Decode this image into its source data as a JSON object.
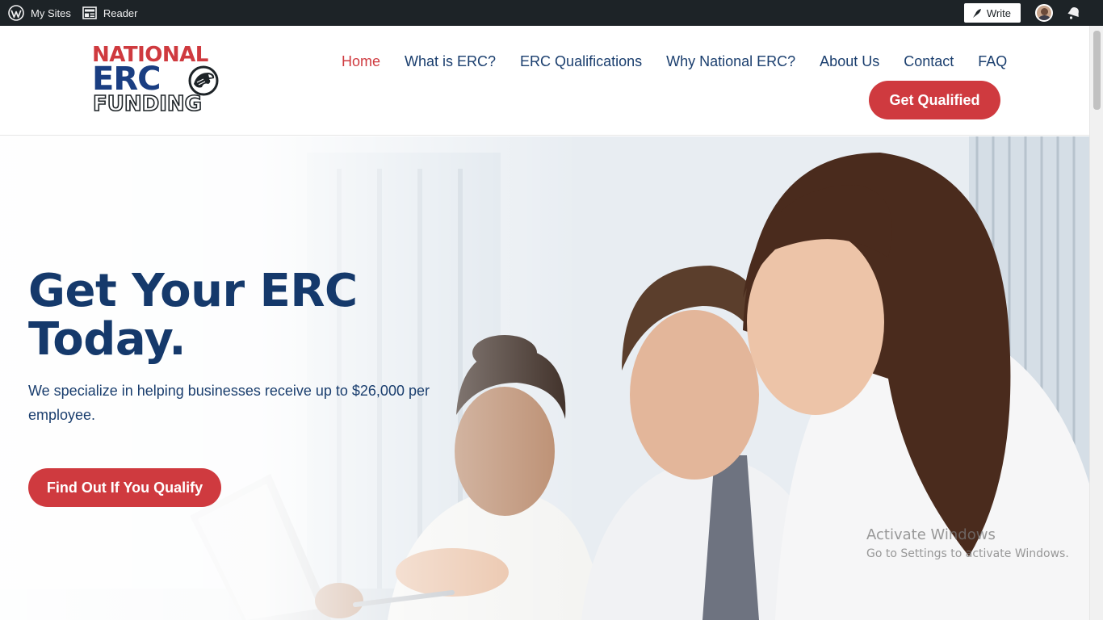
{
  "admin_bar": {
    "my_sites": "My Sites",
    "reader": "Reader",
    "write": "Write"
  },
  "header": {
    "logo": {
      "line1": "NATIONAL",
      "line2": "ERC",
      "line3": "FUNDING"
    },
    "nav": {
      "home": "Home",
      "what_is_erc": "What is ERC?",
      "erc_qualifications": "ERC Qualifications",
      "why_national_erc": "Why National ERC?",
      "about_us": "About Us",
      "contact": "Contact",
      "faq": "FAQ"
    },
    "cta_label": "Get Qualified"
  },
  "hero": {
    "title_line1": "Get Your ERC",
    "title_line2": "Today.",
    "subtitle": "We specialize in helping businesses receive up to $26,000 per employee.",
    "cta_label": "Find Out If You Qualify"
  },
  "watermark": {
    "title": "Activate Windows",
    "subtitle": "Go to Settings to activate Windows."
  },
  "colors": {
    "brand_red": "#cf3a3f",
    "brand_navy": "#15396b",
    "admin_bar": "#1d2327"
  },
  "icons": {
    "wordpress": "wordpress-logo-icon",
    "reader": "reader-icon",
    "write": "feather-pen-icon",
    "notifications": "bell-icon"
  }
}
